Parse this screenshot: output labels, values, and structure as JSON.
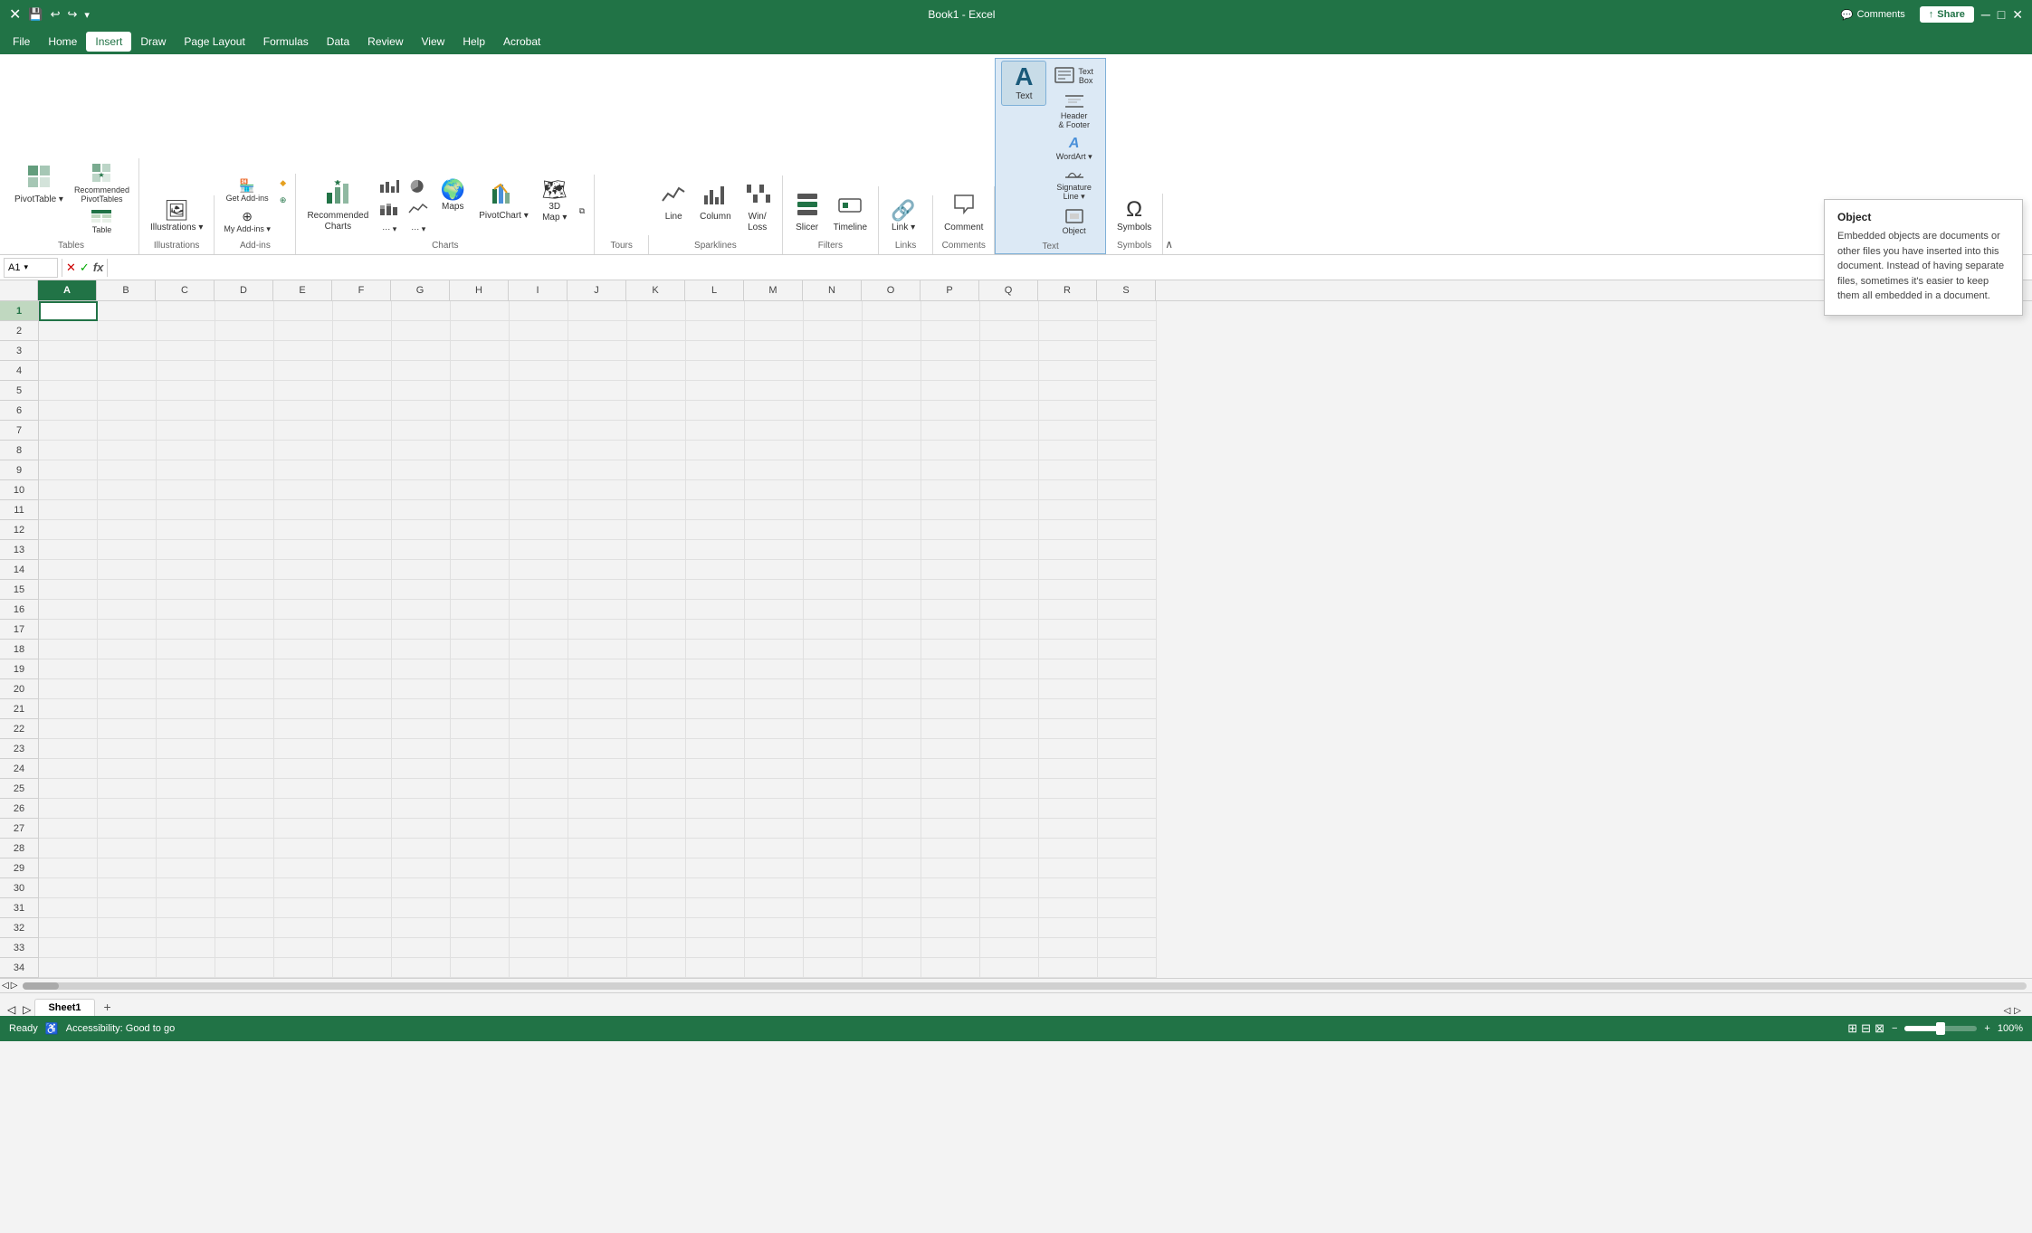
{
  "titlebar": {
    "filename": "Book1 - Excel",
    "comments_label": "Comments",
    "share_label": "Share"
  },
  "menubar": {
    "items": [
      "File",
      "Home",
      "Insert",
      "Draw",
      "Page Layout",
      "Formulas",
      "Data",
      "Review",
      "View",
      "Help",
      "Acrobat"
    ],
    "active": "Insert"
  },
  "ribbon": {
    "groups": [
      {
        "label": "Tables",
        "buttons": [
          {
            "id": "pivot-table",
            "icon": "⊞",
            "label": "PivotTable",
            "sub": true
          },
          {
            "id": "recommended-pivot",
            "icon": "⊟",
            "label": "Recommended\nPivotTables"
          },
          {
            "id": "table",
            "icon": "▦",
            "label": "Table"
          }
        ]
      },
      {
        "label": "Add-ins",
        "buttons": [
          {
            "id": "get-addins",
            "icon": "🏪",
            "label": "Get Add-ins"
          },
          {
            "id": "my-addins",
            "icon": "⊕",
            "label": "My Add-ins",
            "sub": true
          },
          {
            "id": "addins-extra",
            "icon": "🔶",
            "label": ""
          }
        ]
      },
      {
        "label": "Charts",
        "buttons": [
          {
            "id": "recommended-charts",
            "icon": "📊",
            "label": "Recommended\nCharts"
          },
          {
            "id": "col-bar",
            "icon": "📊",
            "label": ""
          },
          {
            "id": "maps",
            "icon": "🌍",
            "label": "Maps"
          },
          {
            "id": "pivot-chart",
            "icon": "📈",
            "label": "PivotChart"
          },
          {
            "id": "3d-map",
            "icon": "🗺",
            "label": "3D\nMap",
            "sub": true
          }
        ]
      },
      {
        "label": "Tours",
        "buttons": []
      },
      {
        "label": "Sparklines",
        "buttons": [
          {
            "id": "line",
            "icon": "📉",
            "label": "Line"
          },
          {
            "id": "column-spark",
            "icon": "▮",
            "label": "Column"
          },
          {
            "id": "win-loss",
            "icon": "±",
            "label": "Win/\nLoss"
          }
        ]
      },
      {
        "label": "Filters",
        "buttons": [
          {
            "id": "slicer",
            "icon": "⧉",
            "label": "Slicer"
          },
          {
            "id": "timeline",
            "icon": "⌚",
            "label": "Timeline"
          }
        ]
      },
      {
        "label": "Links",
        "buttons": [
          {
            "id": "link",
            "icon": "🔗",
            "label": "Link",
            "sub": true
          }
        ]
      },
      {
        "label": "Comments",
        "buttons": [
          {
            "id": "comment",
            "icon": "💬",
            "label": "Comment"
          }
        ]
      },
      {
        "label": "Text",
        "buttons": [
          {
            "id": "text-btn",
            "icon": "A",
            "label": "Text",
            "active": true
          },
          {
            "id": "text-box",
            "icon": "▭",
            "label": "Text\nBox"
          },
          {
            "id": "header-footer",
            "icon": "≡",
            "label": "Header\n& Footer"
          },
          {
            "id": "wordart",
            "icon": "A",
            "label": "WordArt",
            "sub": true
          },
          {
            "id": "signature-line",
            "icon": "✍",
            "label": "Signature\nLine",
            "sub": true
          },
          {
            "id": "object",
            "icon": "⧉",
            "label": "Object"
          }
        ]
      },
      {
        "label": "Symbols",
        "buttons": [
          {
            "id": "symbols",
            "icon": "Ω",
            "label": "Symbols"
          }
        ]
      }
    ]
  },
  "formulabar": {
    "cell_ref": "A1",
    "formula_value": ""
  },
  "columns": [
    "A",
    "B",
    "C",
    "D",
    "E",
    "F",
    "G",
    "H",
    "I",
    "J",
    "K",
    "L",
    "M",
    "N",
    "O",
    "P",
    "Q",
    "R",
    "S"
  ],
  "rows": [
    1,
    2,
    3,
    4,
    5,
    6,
    7,
    8,
    9,
    10,
    11,
    12,
    13,
    14,
    15,
    16,
    17,
    18,
    19,
    20,
    21,
    22,
    23,
    24,
    25,
    26,
    27,
    28,
    29,
    30,
    31,
    32,
    33,
    34
  ],
  "tooltip": {
    "title": "Object",
    "body": "Embedded objects are documents or other files you have inserted into this document. Instead of having separate files, sometimes it's easier to keep them all embedded in a document."
  },
  "statusbar": {
    "ready": "Ready",
    "accessibility": "Accessibility: Good to go",
    "normal_icon": "⊞",
    "page_layout_icon": "⊟",
    "page_break_icon": "⊠",
    "zoom_out": "−",
    "zoom_in": "+",
    "zoom_level": "100%"
  },
  "sheets": {
    "tabs": [
      "Sheet1"
    ],
    "active": "Sheet1",
    "add_label": "+"
  }
}
